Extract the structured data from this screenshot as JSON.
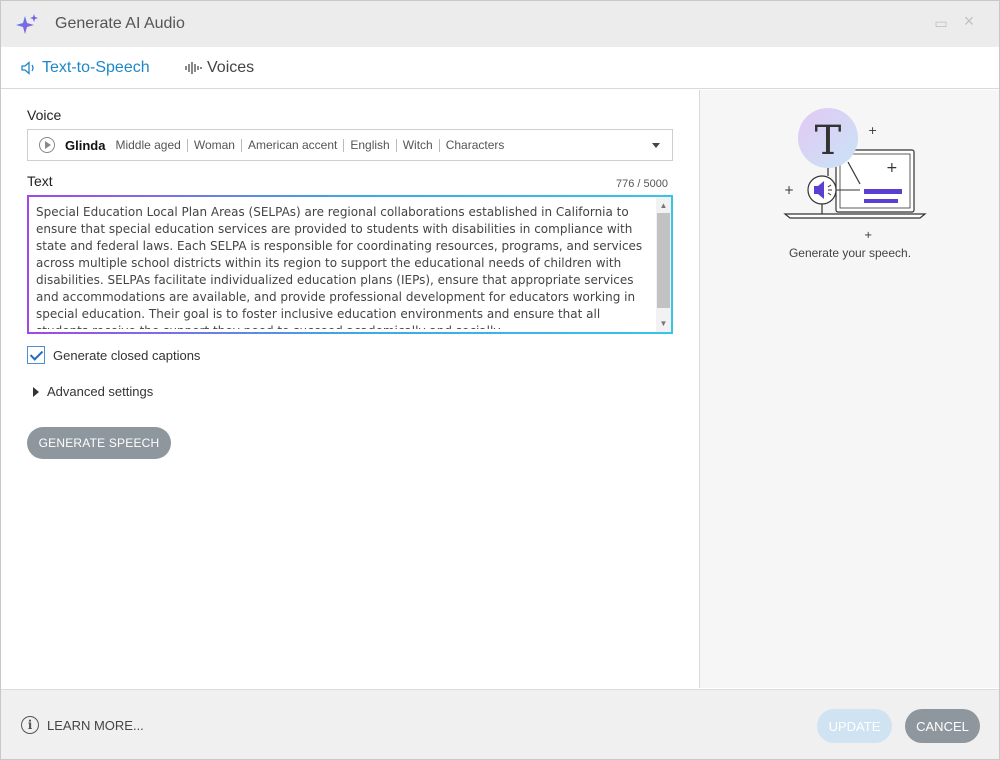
{
  "window": {
    "title": "Generate AI Audio"
  },
  "tabs": [
    {
      "label": "Text-to-Speech",
      "active": true
    },
    {
      "label": "Voices",
      "active": false
    }
  ],
  "voice": {
    "label": "Voice",
    "name": "Glinda",
    "tags": [
      "Middle aged",
      "Woman",
      "American accent",
      "English",
      "Witch",
      "Characters"
    ]
  },
  "text": {
    "label": "Text",
    "char_count": "776 / 5000",
    "content": "Special Education Local Plan Areas (SELPAs) are regional collaborations established in California to ensure that special education services are provided to students with disabilities in compliance with state and federal laws. Each SELPA is responsible for coordinating resources, programs, and services across multiple school districts within its region to support the educational needs of children with disabilities. SELPAs facilitate individualized education plans (IEPs), ensure that appropriate services and accommodations are available, and provide professional development for educators working in special education. Their goal is to foster inclusive education environments and ensure that all students receive the support they need to succeed academically and socially."
  },
  "options": {
    "captions_label": "Generate closed captions",
    "captions_checked": true,
    "advanced_label": "Advanced settings"
  },
  "generate_button": "GENERATE SPEECH",
  "right_panel": {
    "caption": "Generate your speech."
  },
  "footer": {
    "learn_more": "LEARN MORE...",
    "update": "UPDATE",
    "cancel": "CANCEL"
  },
  "colors": {
    "accent": "#1f87c9",
    "gradient_start": "#a247e8",
    "gradient_end": "#36c5e8",
    "button_gray": "#8e979e",
    "illustration_purple": "#5a3fd0"
  }
}
